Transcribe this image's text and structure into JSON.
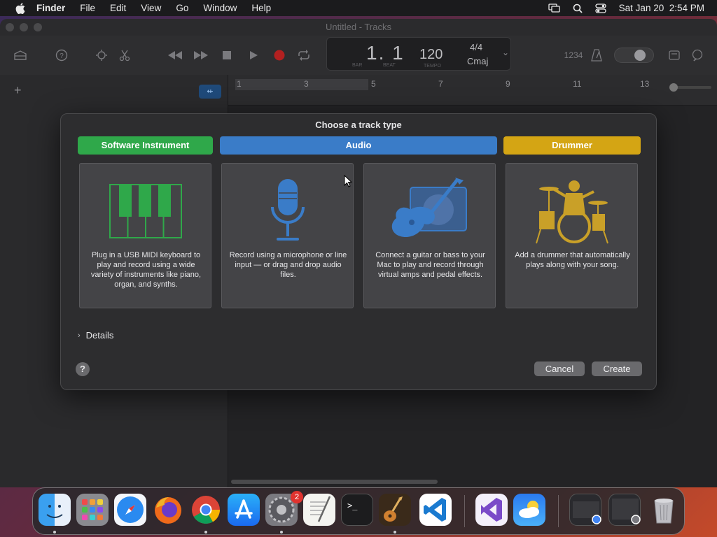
{
  "menubar": {
    "app_name": "Finder",
    "items": [
      "File",
      "Edit",
      "View",
      "Go",
      "Window",
      "Help"
    ],
    "datetime": "Sat Jan 20  2:54 PM"
  },
  "window": {
    "title": "Untitled - Tracks"
  },
  "lcd": {
    "bar": "1. 1",
    "bar_label": "BAR",
    "beat_label": "BEAT",
    "tempo": "120",
    "tempo_label": "TEMPO",
    "time_signature": "4/4",
    "key": "Cmaj",
    "count_label": "1234"
  },
  "ruler": {
    "ticks": [
      "1",
      "3",
      "5",
      "7",
      "9",
      "11",
      "13"
    ]
  },
  "dialog": {
    "title": "Choose a track type",
    "categories": [
      {
        "label": "Software Instrument",
        "color": "#2fa84a"
      },
      {
        "label": "Audio",
        "color": "#3a7cc8"
      },
      {
        "label": "Drummer",
        "color": "#d4a514"
      }
    ],
    "cards": [
      {
        "desc": "Plug in a USB MIDI keyboard to play and record using a wide variety of instruments like piano, organ, and synths."
      },
      {
        "desc": "Record using a microphone or line input — or drag and drop audio files."
      },
      {
        "desc": "Connect a guitar or bass to your Mac to play and record through virtual amps and pedal effects."
      },
      {
        "desc": "Add a drummer that automatically plays along with your song."
      }
    ],
    "details_label": "Details",
    "help_label": "?",
    "cancel_label": "Cancel",
    "create_label": "Create"
  },
  "dock": {
    "settings_badge": "2",
    "apps": [
      "Finder",
      "Launchpad",
      "Safari",
      "Firefox",
      "Chrome",
      "App Store",
      "System Settings",
      "TextEdit",
      "Terminal",
      "GarageBand",
      "VS Code",
      "Visual Studio",
      "Weather",
      "Trash"
    ]
  },
  "colors": {
    "instrument_green": "#2fa84a",
    "audio_blue": "#3a7cc8",
    "drummer_yellow": "#d4a514"
  }
}
